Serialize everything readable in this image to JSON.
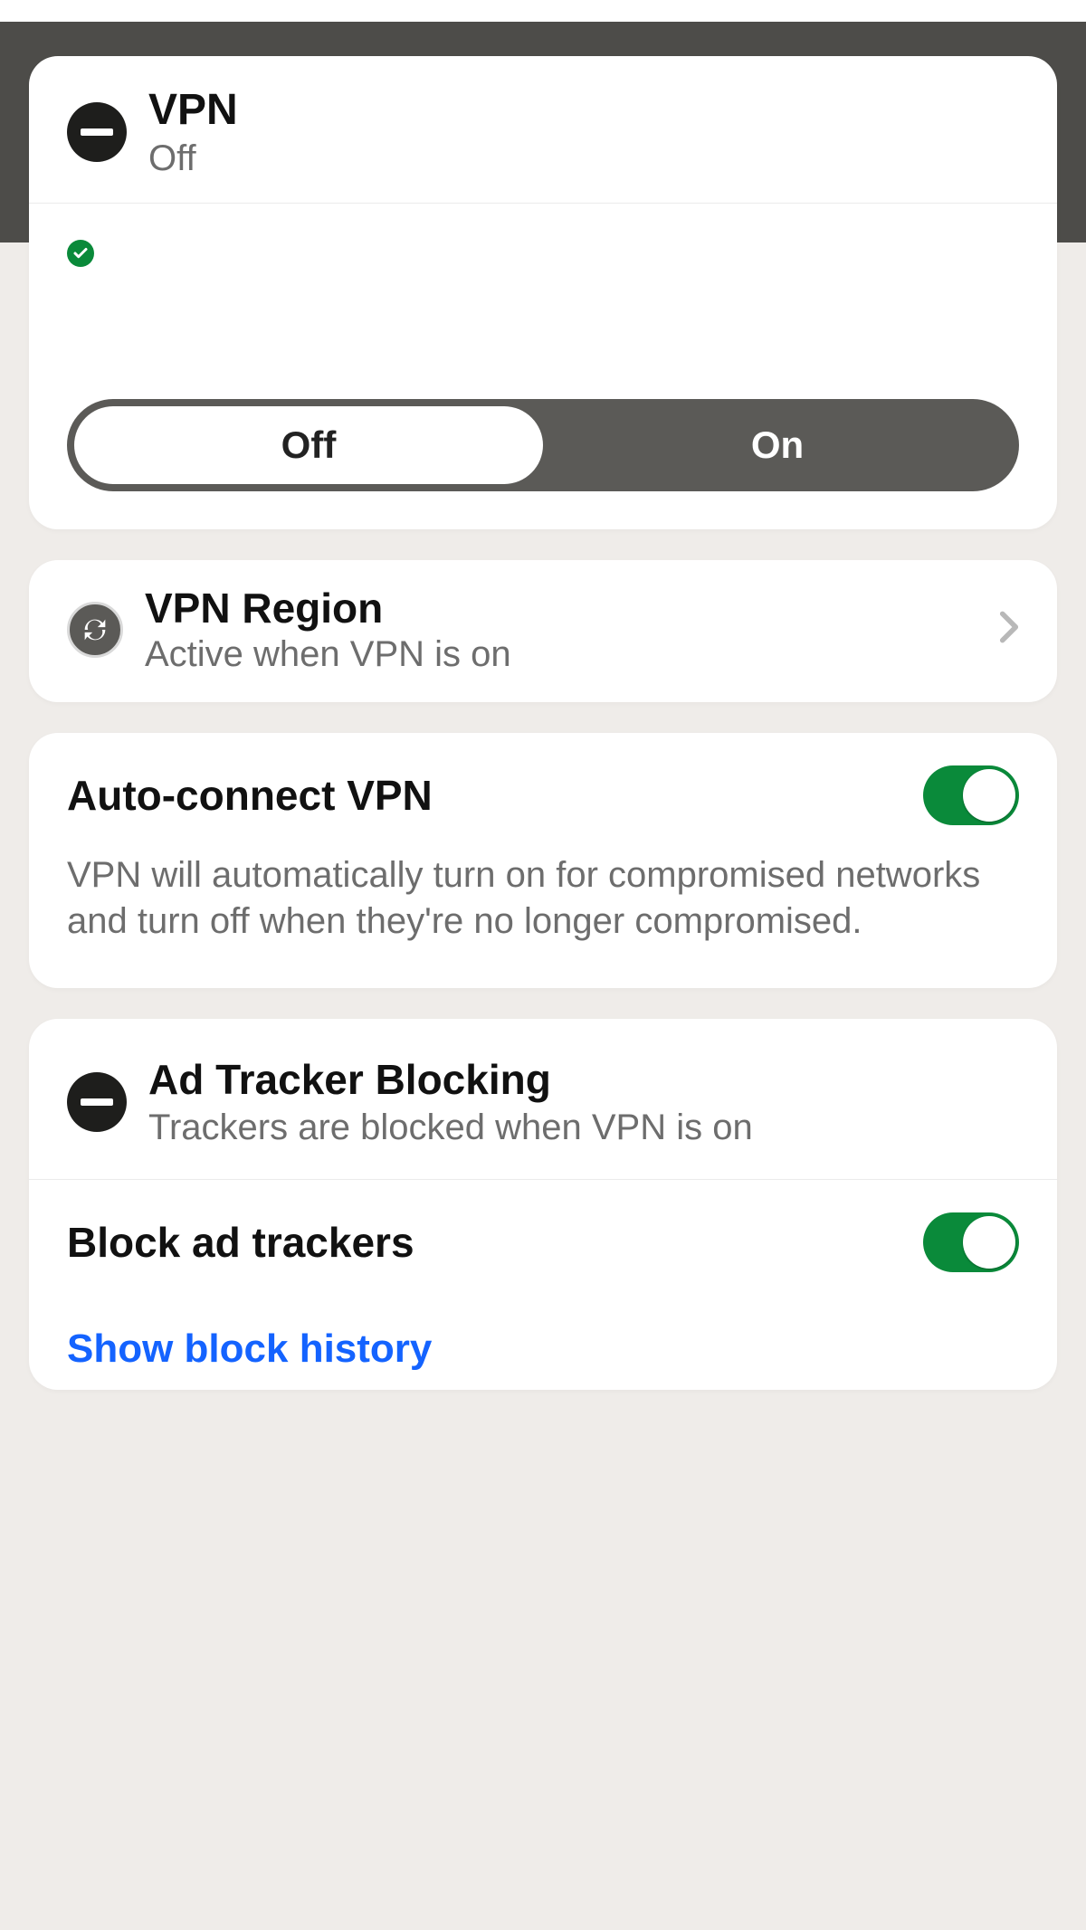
{
  "vpn": {
    "title": "VPN",
    "status": "Off",
    "toggle": {
      "off": "Off",
      "on": "On",
      "active": "off"
    }
  },
  "region": {
    "title": "VPN Region",
    "subtitle": "Active when VPN is on"
  },
  "autoconnect": {
    "title": "Auto-connect VPN",
    "desc": "VPN will automatically turn on for compromised networks and turn off when they're no longer compromised.",
    "enabled": true
  },
  "ads": {
    "title": "Ad Tracker Blocking",
    "subtitle": "Trackers are blocked when VPN is on",
    "block_title": "Block ad trackers",
    "block_enabled": true,
    "history_link": "Show block history"
  }
}
